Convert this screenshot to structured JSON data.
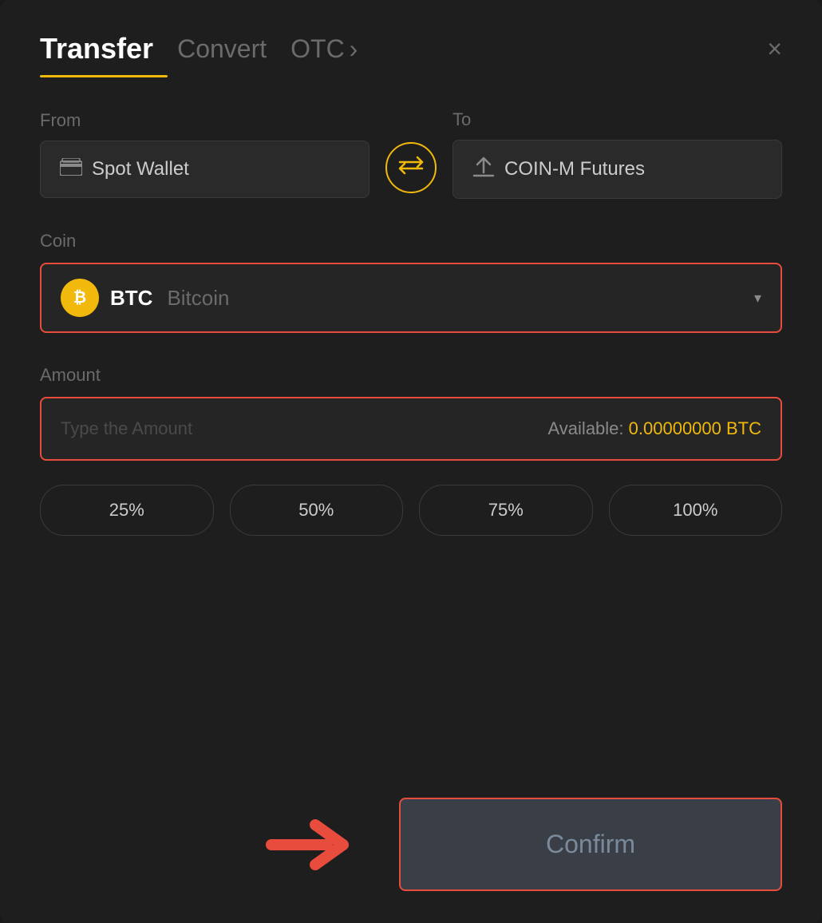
{
  "header": {
    "tab_transfer": "Transfer",
    "tab_convert": "Convert",
    "tab_otc": "OTC",
    "tab_otc_chevron": "›",
    "close_label": "×"
  },
  "from": {
    "label": "From",
    "wallet_icon": "🪪",
    "wallet_text": "Spot Wallet"
  },
  "to": {
    "label": "To",
    "wallet_icon": "↑",
    "wallet_text": "COIN-M Futures"
  },
  "swap": {
    "icon": "⇄"
  },
  "coin": {
    "label": "Coin",
    "symbol": "BTC",
    "name": "Bitcoin",
    "chevron": "▾"
  },
  "amount": {
    "label": "Amount",
    "placeholder": "Type the Amount",
    "available_label": "Available:",
    "available_value": "0.00000000 BTC"
  },
  "percentages": [
    {
      "label": "25%"
    },
    {
      "label": "50%"
    },
    {
      "label": "75%"
    },
    {
      "label": "100%"
    }
  ],
  "confirm": {
    "button_label": "Confirm"
  }
}
